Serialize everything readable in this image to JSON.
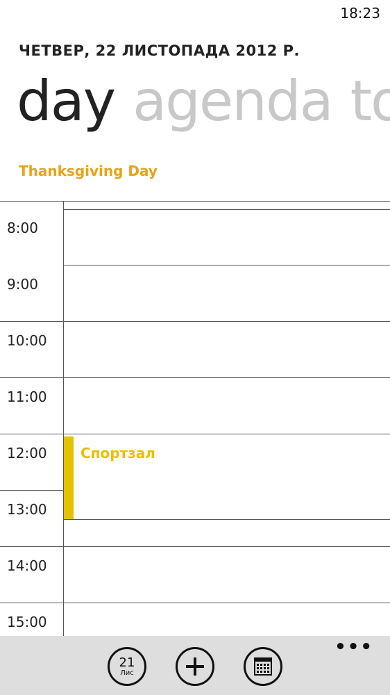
{
  "status_bar": {
    "time": "18:23"
  },
  "header": {
    "date": "ЧЕТВЕР, 22 ЛИСТОПАДА 2012 Р."
  },
  "pivot": {
    "items": [
      "day",
      "agenda",
      "to-do"
    ],
    "active": "day"
  },
  "holiday": {
    "label": "Thanksgiving Day",
    "color": "#e8a317"
  },
  "timeline": {
    "hours": [
      "8:00",
      "9:00",
      "10:00",
      "11:00",
      "12:00",
      "13:00",
      "14:00",
      "15:00"
    ]
  },
  "event": {
    "title": "Спортзал",
    "start": "12:00",
    "color": "#e5c100"
  },
  "app_bar": {
    "today_day": "21",
    "today_month": "Лис",
    "add_icon": "plus-icon",
    "calendar_icon": "calendar-grid-icon",
    "more_icon": "ellipsis-icon",
    "more_label": "•••"
  }
}
